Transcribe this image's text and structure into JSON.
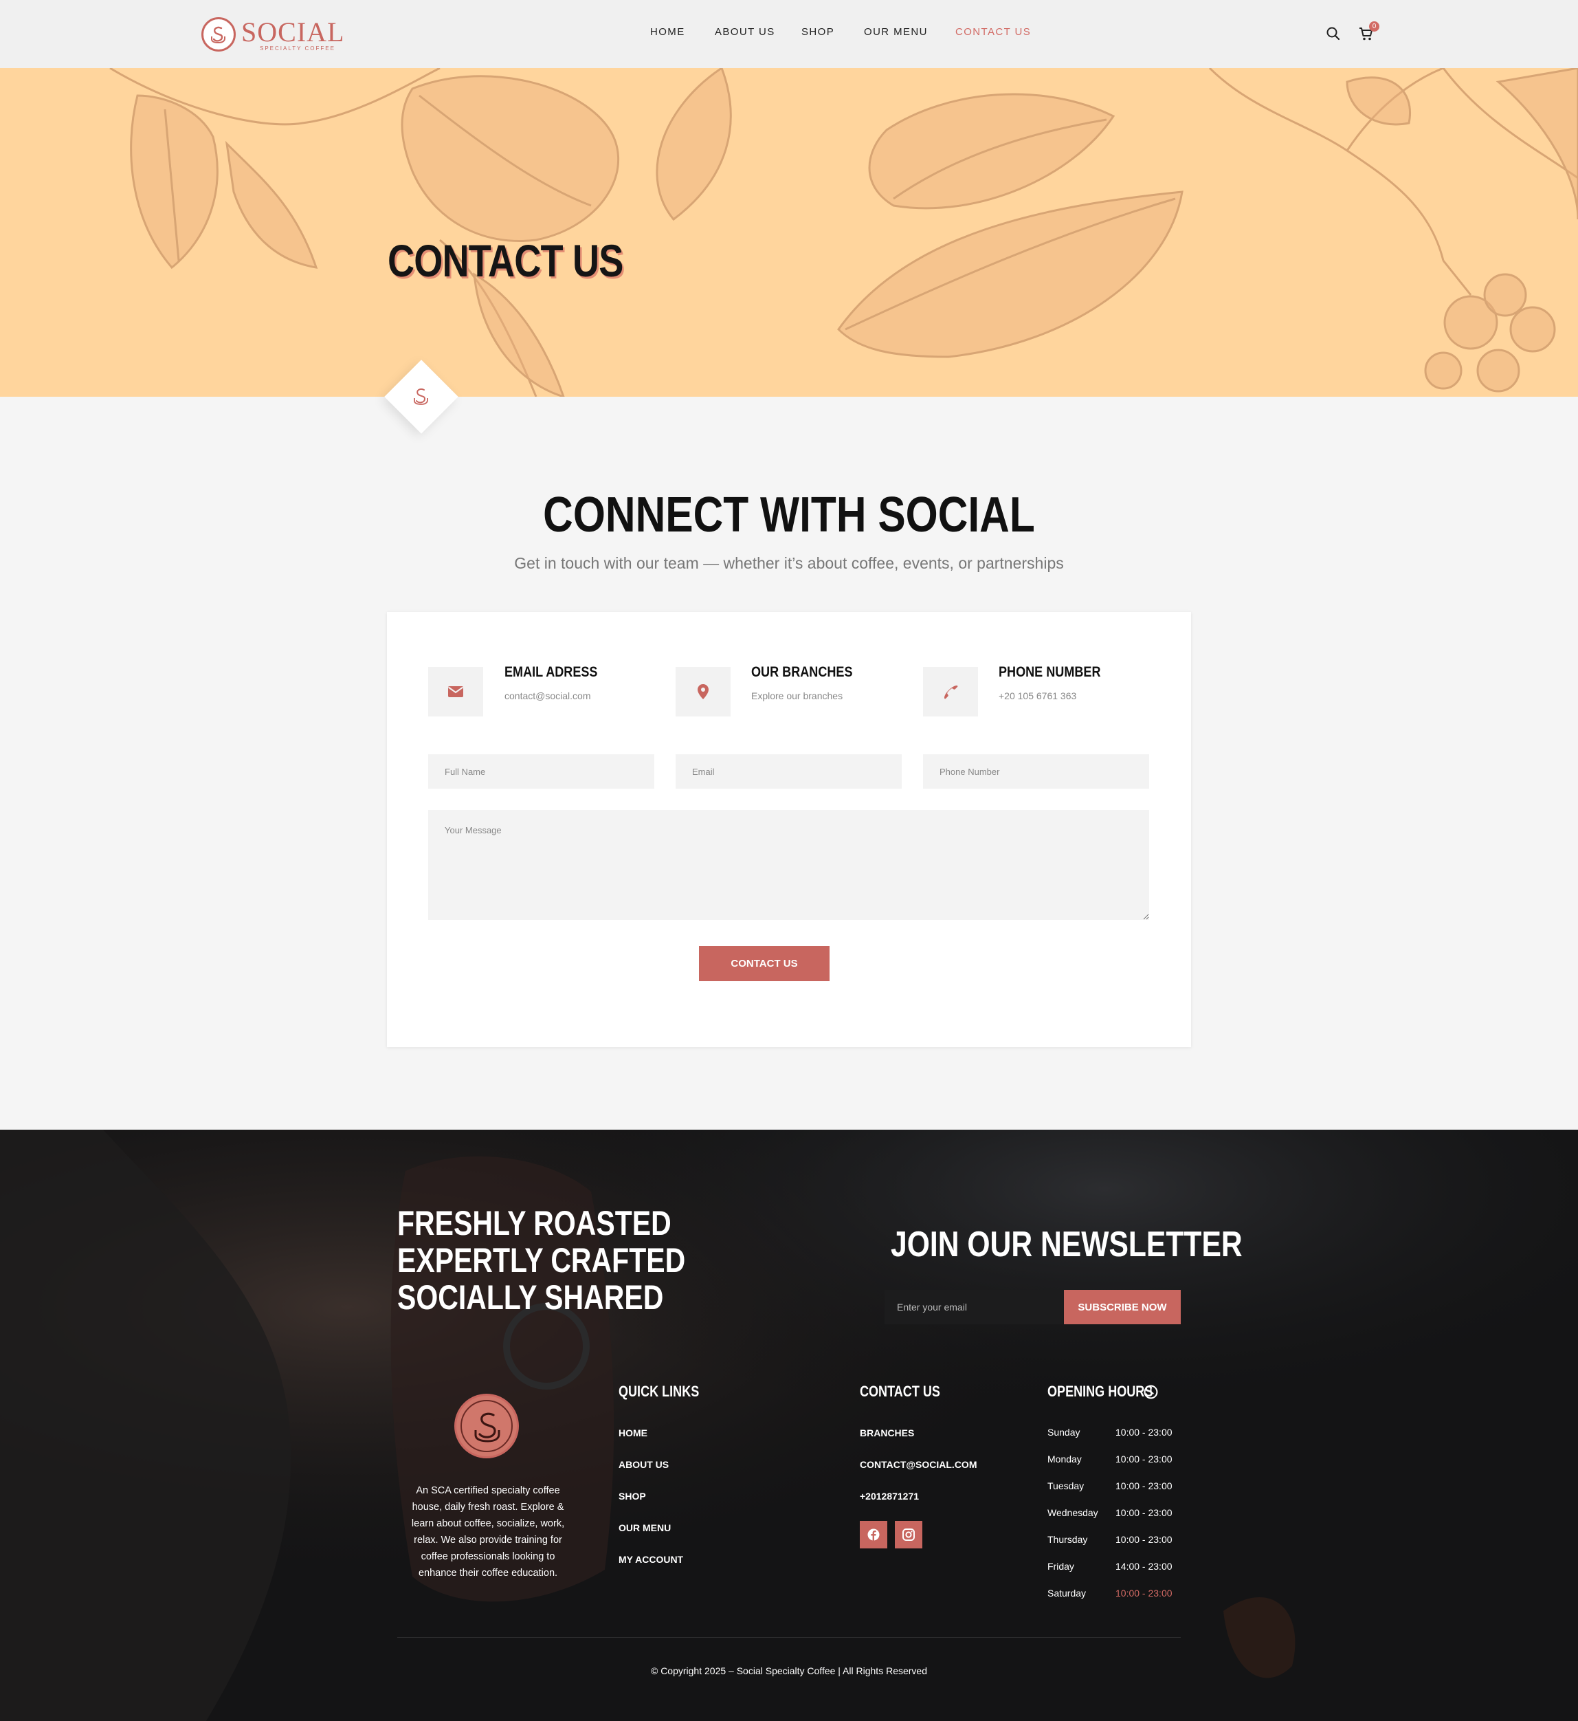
{
  "header": {
    "logo_text": "SOCIAL",
    "logo_sub": "SPECIALTY COFFEE",
    "nav": [
      "HOME",
      "ABOUT US",
      "SHOP",
      "OUR MENU",
      "CONTACT US"
    ],
    "active_nav": "CONTACT US",
    "cart_count": "0",
    "icons": [
      "search-icon",
      "cart-icon"
    ]
  },
  "hero": {
    "title": "CONTACT US",
    "background_color": "#ffd59d"
  },
  "connect": {
    "title": "CONNECT WITH SOCIAL",
    "subtitle": "Get in touch with our team — whether it’s about coffee, events, or partnerships",
    "info": [
      {
        "icon": "envelope-icon",
        "title": "EMAIL ADRESS",
        "value": "contact@social.com"
      },
      {
        "icon": "map-pin-icon",
        "title": "OUR BRANCHES",
        "value": "Explore our branches"
      },
      {
        "icon": "phone-icon",
        "title": "PHONE NUMBER",
        "value": "+20 105 6761 363"
      }
    ],
    "form": {
      "name_placeholder": "Full Name",
      "email_placeholder": "Email",
      "phone_placeholder": "Phone Number",
      "message_placeholder": "Your Message",
      "submit_label": "CONTACT US"
    }
  },
  "footer": {
    "tagline": [
      "FRESHLY ROASTED",
      "EXPERTLY CRAFTED",
      "SOCIALLY SHARED"
    ],
    "newsletter": {
      "title": "JOIN OUR NEWSLETTER",
      "placeholder": "Enter your email",
      "button": "SUBSCRIBE NOW"
    },
    "about": "An SCA certified specialty coffee house, daily fresh roast. Explore & learn about coffee, socialize, work, relax. We also provide training for coffee professionals looking to enhance their coffee education.",
    "quick_links": {
      "title": "QUICK LINKS",
      "items": [
        "HOME",
        "ABOUT US",
        "SHOP",
        "OUR MENU",
        "MY ACCOUNT"
      ]
    },
    "contact": {
      "title": "CONTACT US",
      "items": [
        "BRANCHES",
        "CONTACT@SOCIAL.COM",
        "+2012871271"
      ],
      "social": [
        "facebook-icon",
        "instagram-icon"
      ]
    },
    "hours": {
      "title": "OPENING HOURS",
      "rows": [
        {
          "day": "Sunday",
          "time": "10:00 - 23:00"
        },
        {
          "day": "Monday",
          "time": "10:00 - 23:00"
        },
        {
          "day": "Tuesday",
          "time": "10:00 - 23:00"
        },
        {
          "day": "Wednesday",
          "time": "10:00 - 23:00"
        },
        {
          "day": "Thursday",
          "time": "10:00 - 23:00"
        },
        {
          "day": "Friday",
          "time": "14:00 - 23:00"
        },
        {
          "day": "Saturday",
          "time": "10:00 - 23:00"
        }
      ]
    },
    "copyright": "© Copyright 2025 – Social Specialty Coffee | All Rights Reserved"
  },
  "colors": {
    "accent": "#c8665f",
    "hero_bg": "#ffd59d",
    "footer_bg": "#121213"
  }
}
